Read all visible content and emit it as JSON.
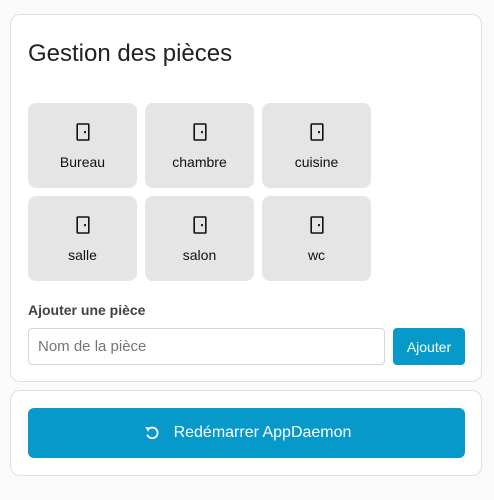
{
  "rooms_card": {
    "title": "Gestion des pièces",
    "rooms": [
      {
        "label": "Bureau",
        "icon": "door-icon"
      },
      {
        "label": "chambre",
        "icon": "door-icon"
      },
      {
        "label": "cuisine",
        "icon": "door-icon"
      },
      {
        "label": "salle",
        "icon": "door-icon"
      },
      {
        "label": "salon",
        "icon": "door-icon"
      },
      {
        "label": "wc",
        "icon": "door-icon"
      }
    ],
    "add_room": {
      "label": "Ajouter une pièce",
      "input_placeholder": "Nom de la pièce",
      "input_value": "",
      "button_label": "Ajouter"
    }
  },
  "restart_card": {
    "button_label": "Redémarrer AppDaemon",
    "icon": "restart-icon"
  },
  "colors": {
    "accent": "#0799c9",
    "tile_background": "#e5e5e5",
    "card_border": "#e0e0e0"
  }
}
